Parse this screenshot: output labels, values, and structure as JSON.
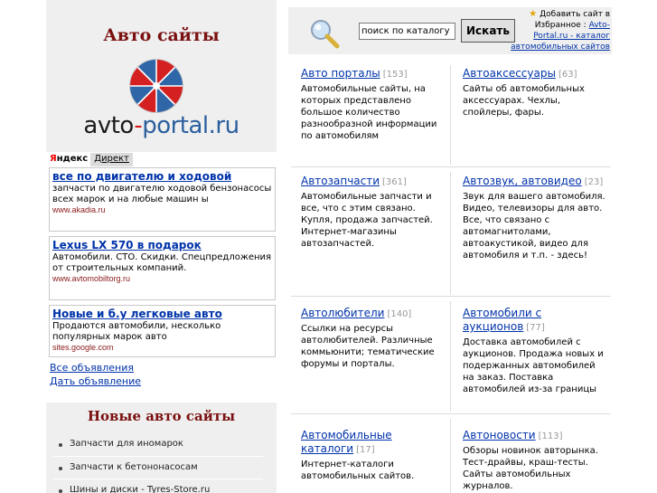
{
  "site": {
    "title": "Авто сайты",
    "logo_text_a": "avto",
    "logo_text_dash": "-",
    "logo_text_b": "portal.ru"
  },
  "ads": {
    "tab_yandex_y": "Я",
    "tab_yandex_rest": "ндекс",
    "tab_direct": "Директ",
    "items": [
      {
        "title": "все по двигателю и ходовой",
        "text": "запчасти по двигателю ходовой бензонасосы всех марок и на любые машин ы",
        "url": "www.akadia.ru"
      },
      {
        "title": "Lexus LX 570 в подарок",
        "text": "Автомобили. СТО. Скидки. Спецпредложения от строительных компаний.",
        "url": "www.avtomobiltorg.ru"
      },
      {
        "title": "Новые и б.у легковые авто",
        "text": "Продаются автомобили, несколько популярных марок авто",
        "url": "sites.google.com"
      }
    ],
    "all_link": "Все объявления",
    "give_link": "Дать объявление"
  },
  "new_sites": {
    "title": "Новые авто сайты",
    "items": [
      "Запчасти для иномарок",
      "Запчасти к бетононасосам",
      "Шины и диски - Tyres-Store.ru"
    ]
  },
  "search": {
    "placeholder": "поиск по каталогу",
    "button": "Искать"
  },
  "favorites": {
    "star": "★",
    "line1": "Добавить сайт в",
    "line2": "Избранное :",
    "link": "Avto-Portal.ru - каталог автомобильных сайтов"
  },
  "categories": [
    {
      "title": "Авто порталы",
      "count": "[153]",
      "desc": "Автомобильные сайты, на которых представлено большое количество разнообразной информации по автомобилям"
    },
    {
      "title": "Автоаксессуары",
      "count": "[63]",
      "desc": "Сайты об автомобильных аксессуарах. Чехлы, спойлеры, фары."
    },
    {
      "title": "Автозапчасти",
      "count": "[361]",
      "desc": "Автомобильные запчасти и все, что с этим связано. Купля, продажа запчастей. Интернет-магазины автозапчастей."
    },
    {
      "title": "Автозвук, автовидео",
      "count": "[23]",
      "desc": "Звук для вашего автомобиля. Видео, телевизоры для авто. Все, что связано с автомагнитолами, автоакустикой, видео для автомобиля и т.п. - здесь!"
    },
    {
      "title": "Автолюбители",
      "count": "[140]",
      "desc": "Ссылки на ресурсы автолюбителей. Различные коммьюнити; тематические форумы и порталы."
    },
    {
      "title": "Автомобили с аукционов",
      "count": "[77]",
      "desc": "Доставка автомобилей с аукционов. Продажа новых и подержанных автомобилей на заказ. Поставка автомобилей из-за границы"
    },
    {
      "title": "Автомобильные каталоги",
      "count": "[17]",
      "desc": "Интернет-каталоги автомобильных сайтов."
    },
    {
      "title": "Автоновости",
      "count": "[113]",
      "desc": "Обзоры новинок авторынка. Тест-драйвы, краш-тесты. Сайты автомобильных журналов."
    }
  ]
}
